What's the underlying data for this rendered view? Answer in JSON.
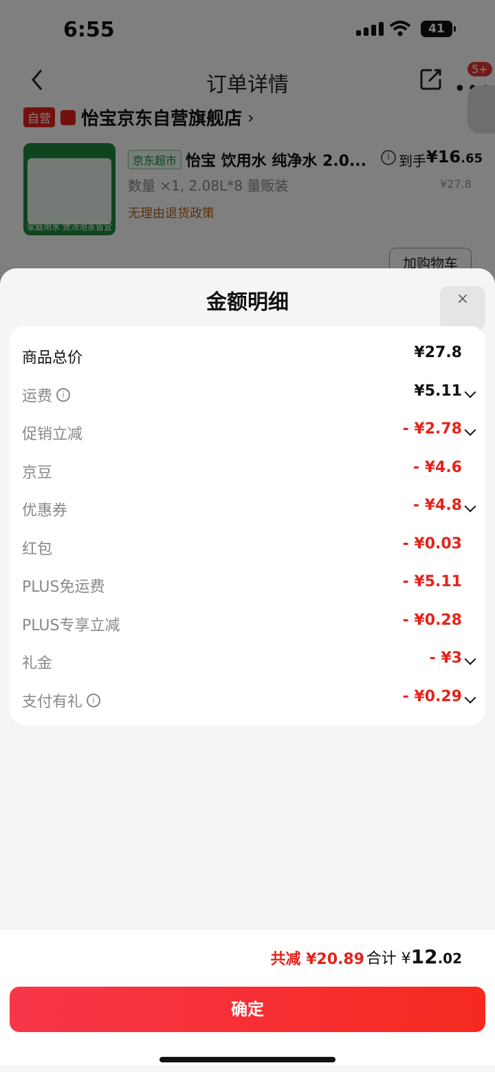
{
  "status_bar": {
    "time": "6:55",
    "battery": "41"
  },
  "nav": {
    "title": "订单详情",
    "more_badge": "5+"
  },
  "store": {
    "self_operated_tag": "自营",
    "name": "怡宝京东自营旗舰店"
  },
  "product": {
    "channel_tag": "京东超市",
    "title": "怡宝 饮用水 纯净水 2.0...",
    "price_label": "到手",
    "price_currency": "¥",
    "price_int": "16",
    "price_dec": ".65",
    "original_price": "¥27.8",
    "quantity_info": "数量 ×1, 2.08L*8 量贩装",
    "return_policy": "无理由退货政策",
    "image_caption": "家庭用水 煲汤泡茶皆宜",
    "add_to_cart": "加购物车"
  },
  "sheet": {
    "title": "金额明细",
    "close": "×",
    "rows": [
      {
        "label": "商品总价",
        "value": "¥27.8"
      },
      {
        "label": "运费",
        "value": "¥5.11"
      },
      {
        "label": "促销立减",
        "value": "- ¥2.78"
      },
      {
        "label": "京豆",
        "value": "- ¥4.6"
      },
      {
        "label": "优惠券",
        "value": "- ¥4.8"
      },
      {
        "label": "红包",
        "value": "- ¥0.03"
      },
      {
        "label": "PLUS免运费",
        "value": "- ¥5.11"
      },
      {
        "label": "PLUS专享立减",
        "value": "- ¥0.28"
      },
      {
        "label": "礼金",
        "value": "- ¥3"
      },
      {
        "label": "支付有礼",
        "value": "- ¥0.29"
      }
    ]
  },
  "footer": {
    "saving": "共减 ¥20.89",
    "total_label": "合计",
    "total_currency": "¥",
    "total_int": "12",
    "total_dec": ".02",
    "confirm": "确定"
  },
  "colors": {
    "accent": "#e5231a",
    "button_start": "#f7364a",
    "button_end": "#f5291f"
  }
}
